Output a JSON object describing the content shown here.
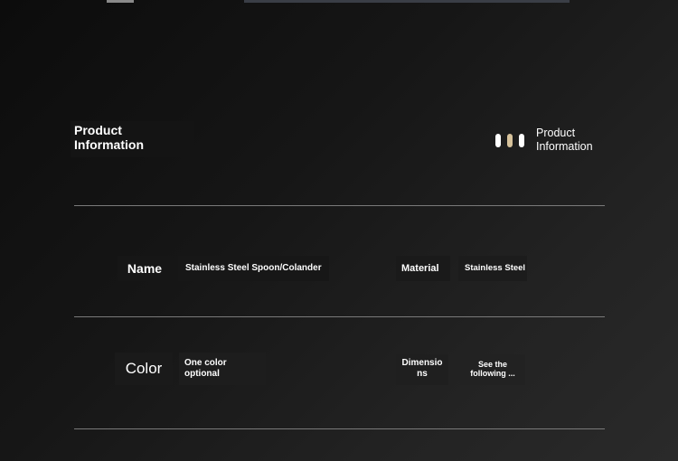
{
  "header": {
    "title_line1": "Product",
    "title_line2": "Information",
    "badge_line1": "Product",
    "badge_line2": "Information",
    "pill_colors": [
      "#ffffff",
      "#d6c29b",
      "#ffffff"
    ]
  },
  "specs": {
    "name_label": "Name",
    "name_value": "Stainless Steel Spoon/Colander",
    "material_label": "Material",
    "material_value": "Stainless Steel",
    "color_label": "Color",
    "color_value_line1": "One color",
    "color_value_line2": "optional",
    "dimensions_label_line1": "Dimensio",
    "dimensions_label_line2": "ns",
    "dimensions_value_line1": "See the",
    "dimensions_value_line2": "following ..."
  }
}
